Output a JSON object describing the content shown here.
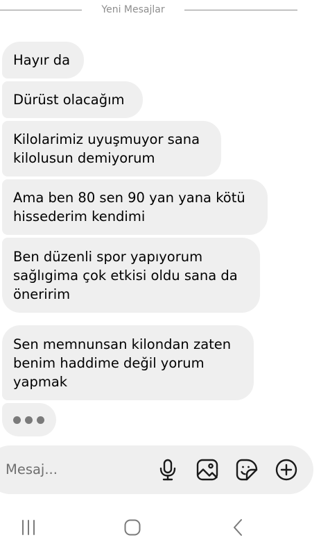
{
  "divider": {
    "label": "Yeni Mesajlar"
  },
  "messages": [
    {
      "text": "Hayır da"
    },
    {
      "text": "Dürüst olacağım"
    },
    {
      "text": "Kilolarimiz uyuşmuyor sana\nkilolusun demiyorum"
    },
    {
      "text": "Ama ben 80 sen 90 yan yana kötü\nhissederim kendimi"
    },
    {
      "text": "Ben düzenli spor yapıyorum\nsağlıgima çok etkisi oldu sana da\nöneririm"
    },
    {
      "text": "Sen memnunsan kilondan zaten\nbenim haddime değil yorum\nyapmak"
    }
  ],
  "typing_indicator": {
    "icon": "typing-dots"
  },
  "composer": {
    "placeholder": "Mesaj...",
    "icons": [
      "microphone-icon",
      "gallery-icon",
      "sticker-icon",
      "plus-icon"
    ]
  },
  "navbar": {
    "icons": [
      "recents-icon",
      "home-icon",
      "back-icon"
    ]
  },
  "colors": {
    "bubble": "#efefef",
    "text": "#000000",
    "muted": "#8e8e8e",
    "icon": "#1a1a1a"
  }
}
